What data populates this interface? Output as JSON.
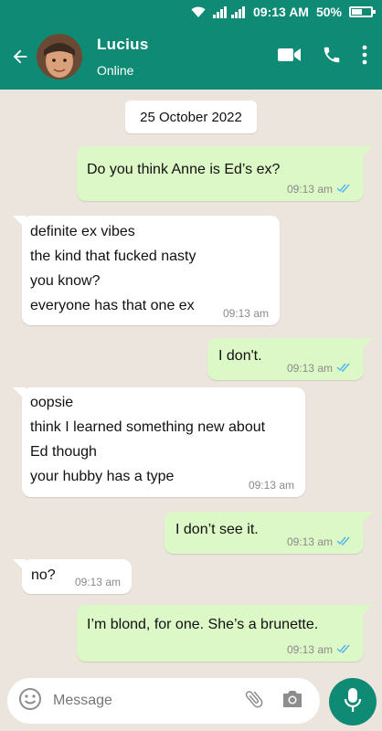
{
  "statusbar": {
    "time": "09:13 AM",
    "battery": "50%"
  },
  "header": {
    "contact_name": "Lucius",
    "contact_status": "Online"
  },
  "chat": {
    "date": "25 October 2022",
    "messages": [
      {
        "direction": "outgoing",
        "lines": [
          "Do you think Anne is Ed’s ex?"
        ],
        "time": "09:13 am",
        "read": true
      },
      {
        "direction": "incoming",
        "lines": [
          "definite ex vibes",
          "the kind that fucked nasty",
          "you know?",
          "everyone has that one ex"
        ],
        "time": "09:13 am"
      },
      {
        "direction": "outgoing",
        "lines": [
          "I don't."
        ],
        "time": "09:13 am",
        "read": true
      },
      {
        "direction": "incoming",
        "lines": [
          "oopsie",
          "think I learned something new about",
          "Ed though",
          "your hubby has a type"
        ],
        "time": "09:13 am"
      },
      {
        "direction": "outgoing",
        "lines": [
          "I don’t see it."
        ],
        "time": "09:13 am",
        "read": true
      },
      {
        "direction": "incoming",
        "lines": [
          "no?"
        ],
        "time": "09:13 am"
      },
      {
        "direction": "outgoing",
        "lines": [
          "I’m blond, for one. She’s a brunette."
        ],
        "time": "09:13 am",
        "read": true
      }
    ]
  },
  "composer": {
    "placeholder": "Message"
  },
  "colors": {
    "header": "#0f8a74",
    "outgoing_bubble": "#dcf8c6",
    "incoming_bubble": "#ffffff",
    "chat_background": "#ece5dd",
    "read_ticks": "#4fb6ec"
  }
}
